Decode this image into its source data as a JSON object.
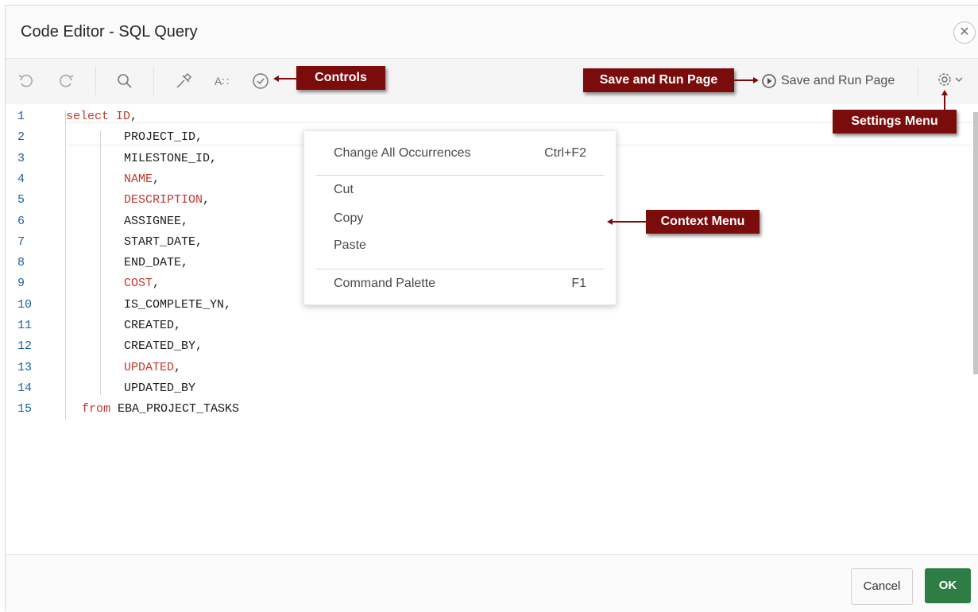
{
  "dialog": {
    "title": "Code Editor - SQL Query",
    "close_icon": "close-icon"
  },
  "toolbar": {
    "icons": [
      "undo-icon",
      "redo-icon",
      "search-icon",
      "format-icon",
      "autocomplete-icon",
      "validate-icon"
    ],
    "save_run_label": "Save and Run Page",
    "settings_icon": "gear-icon"
  },
  "editor": {
    "lines": [
      {
        "n": "1",
        "kw": "select",
        "text": " ",
        "col": "ID",
        "after": ","
      },
      {
        "n": "2",
        "text": "PROJECT_ID,"
      },
      {
        "n": "3",
        "text": "MILESTONE_ID,"
      },
      {
        "n": "4",
        "col": "NAME",
        "after": ","
      },
      {
        "n": "5",
        "col": "DESCRIPTION",
        "after": ","
      },
      {
        "n": "6",
        "text": "ASSIGNEE,"
      },
      {
        "n": "7",
        "text": "START_DATE,"
      },
      {
        "n": "8",
        "text": "END_DATE,"
      },
      {
        "n": "9",
        "col": "COST",
        "after": ","
      },
      {
        "n": "10",
        "text": "IS_COMPLETE_YN,"
      },
      {
        "n": "11",
        "text": "CREATED,"
      },
      {
        "n": "12",
        "text": "CREATED_BY,"
      },
      {
        "n": "13",
        "col": "UPDATED",
        "after": ","
      },
      {
        "n": "14",
        "text": "UPDATED_BY"
      },
      {
        "n": "15",
        "kw": "from",
        "text": " EBA_PROJECT_TASKS"
      }
    ]
  },
  "context_menu": {
    "items": [
      {
        "label": "Change All Occurrences",
        "shortcut": "Ctrl+F2"
      },
      {
        "label": "Cut",
        "shortcut": ""
      },
      {
        "label": "Copy",
        "shortcut": ""
      },
      {
        "label": "Paste",
        "shortcut": ""
      },
      {
        "label": "Command Palette",
        "shortcut": "F1"
      }
    ]
  },
  "footer": {
    "cancel_label": "Cancel",
    "ok_label": "OK"
  },
  "callouts": {
    "controls": "Controls",
    "save_run": "Save and Run Page",
    "settings": "Settings Menu",
    "context": "Context Menu"
  },
  "colors": {
    "callout_bg": "#7b0c0c",
    "ok_bg": "#2e7d45",
    "keyword": "#c0392b",
    "line_number": "#1f5fa0"
  }
}
